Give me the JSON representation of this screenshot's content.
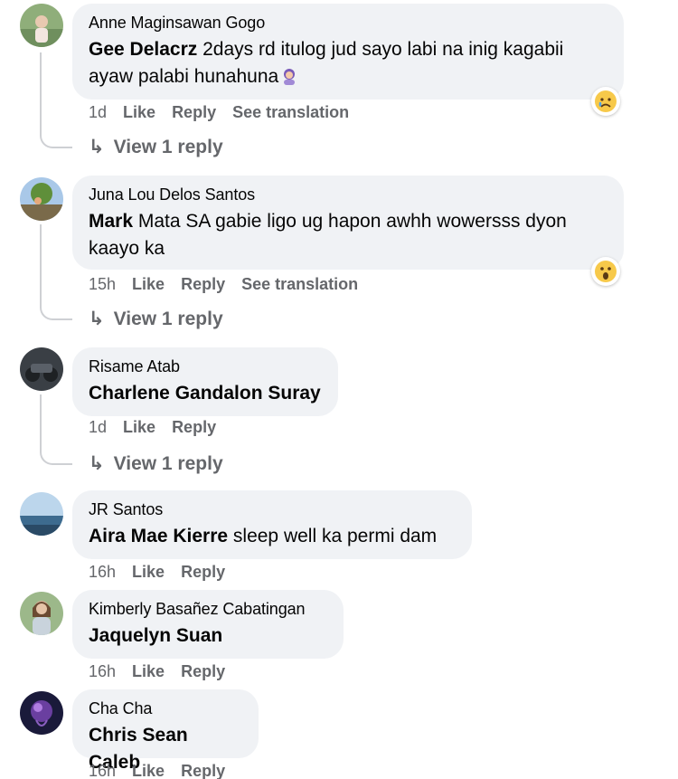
{
  "comments": [
    {
      "author": "Anne Maginsawan Gogo",
      "mention": "Gee Delacrz",
      "text": " 2days rd itulog jud sayo labi na inig kagabii ayaw palabi hunahuna",
      "time": "1d",
      "like": "Like",
      "reply": "Reply",
      "translate": "See translation",
      "reaction": "sad-face",
      "view_replies": "View 1 reply"
    },
    {
      "author": "Juna Lou Delos Santos",
      "mention": "Mark",
      "text": " Mata SA gabie ligo ug hapon awhh wowersss dyon kaayo ka",
      "time": "15h",
      "like": "Like",
      "reply": "Reply",
      "translate": "See translation",
      "reaction": "wow-face",
      "view_replies": "View 1 reply"
    },
    {
      "author": "Risame Atab",
      "mention": "Charlene Gandalon Suray",
      "text": "",
      "time": "1d",
      "like": "Like",
      "reply": "Reply",
      "view_replies": "View 1 reply"
    },
    {
      "author": "JR Santos",
      "mention": "Aira Mae Kierre",
      "text": " sleep well ka permi dam",
      "time": "16h",
      "like": "Like",
      "reply": "Reply"
    },
    {
      "author": "Kimberly Basañez Cabatingan",
      "mention": "Jaquelyn Suan",
      "text": "",
      "time": "16h",
      "like": "Like",
      "reply": "Reply"
    },
    {
      "author": "Cha Cha",
      "mention": "Chris Sean Caleb",
      "text": "",
      "time": "16h",
      "like": "Like",
      "reply": "Reply"
    }
  ],
  "colors": {
    "bubble": "#f0f2f5",
    "meta": "#65676b",
    "text": "#050505"
  }
}
